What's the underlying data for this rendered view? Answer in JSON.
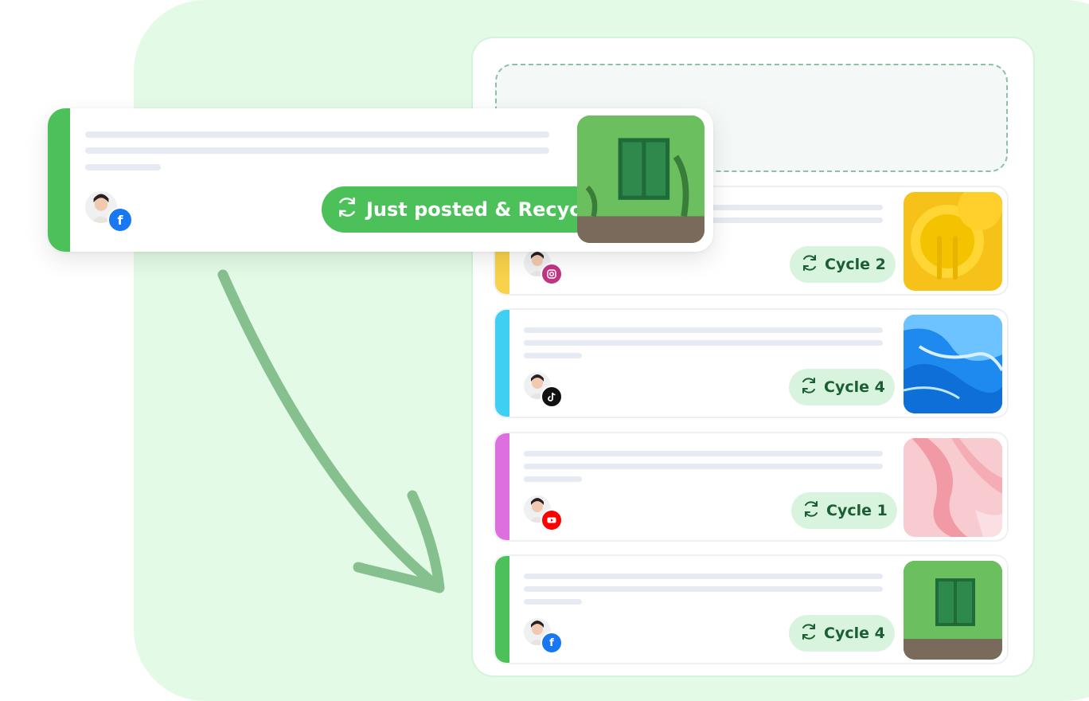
{
  "featured": {
    "status_label": "Just posted & Recycled",
    "network": "facebook",
    "stripe_color": "#4cc159",
    "status_icon": "recycle-icon"
  },
  "queue": [
    {
      "cycle_label": "Cycle 2",
      "network": "instagram",
      "stripe_color": "#f9d24b",
      "thumb": "yellow-plate-image"
    },
    {
      "cycle_label": "Cycle 4",
      "network": "tiktok",
      "stripe_color": "#3fcff2",
      "thumb": "blue-marble-image"
    },
    {
      "cycle_label": "Cycle 1",
      "network": "youtube",
      "stripe_color": "#dd6fde",
      "thumb": "pink-fabric-image"
    },
    {
      "cycle_label": "Cycle 4",
      "network": "facebook",
      "stripe_color": "#4cc159",
      "thumb": "green-window-image"
    }
  ],
  "colors": {
    "accent_green": "#4cc159",
    "pill_bg": "#d9f4de",
    "pill_text": "#1b5e33",
    "background_panel": "#e3fbe6"
  }
}
